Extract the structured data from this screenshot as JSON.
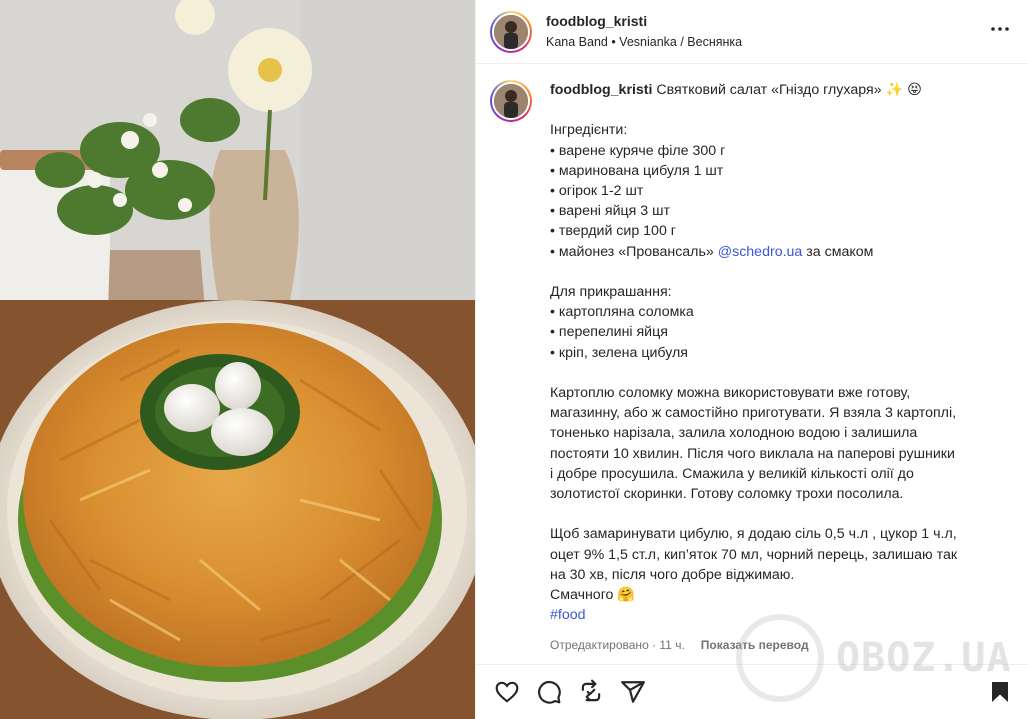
{
  "post": {
    "username": "foodblog_kristi",
    "music": "Kana Band • Vesnianka / Веснянка",
    "more_icon": "more-horizontal-icon"
  },
  "caption": {
    "username": "foodblog_kristi",
    "title": "Святковий салат «Гніздо глухаря» ✨ 😝",
    "lines": [
      "",
      "Інгредієнти:",
      "• варене куряче філе 300 г",
      "• маринована цибуля 1 шт",
      "• огірок 1-2 шт",
      "• варені яйця 3 шт",
      "• твердий сир 100 г",
      "",
      "",
      "Для прикрашання:",
      "• картопляна соломка",
      "• перепелині яйця",
      "• кріп, зелена цибуля",
      "",
      "Картоплю соломку можна використовувати вже готову,",
      "магазинну, або ж самостійно приготувати. Я взяла 3 картоплі,",
      "тоненько нарізала, залила холодною водою і залишила",
      "постояти 10 хвилин. Після чого виклала на паперові рушники",
      "і добре просушила. Смажила у великій кількості олії до",
      "золотистої скоринки. Готову соломку трохи посолила.",
      "",
      "Щоб замаринувати цибулю, я додаю сіль 0,5 ч.л , цукор 1 ч.л,",
      "оцет 9% 1,5 ст.л, кип’яток 70 мл, чорний перець, залишаю так",
      "на 30 хв, після чого добре віджимаю.",
      "Смачного 🤗"
    ],
    "mayo_prefix": "• майонез «Провансаль»",
    "mayo_mention": "@schedro.ua",
    "mayo_suffix": "за смаком",
    "hashtag": "#food",
    "edited": "Отредактировано · 11 ч.",
    "translate": "Показать перевод"
  },
  "actions": {
    "like_icon": "heart-icon",
    "comment_icon": "comment-icon",
    "repost_icon": "repost-icon",
    "share_icon": "send-icon",
    "save_icon": "bookmark-icon"
  },
  "watermark": "OBOZ.UA",
  "colors": {
    "link": "#00376b",
    "muted": "#737373",
    "text": "#262626"
  }
}
